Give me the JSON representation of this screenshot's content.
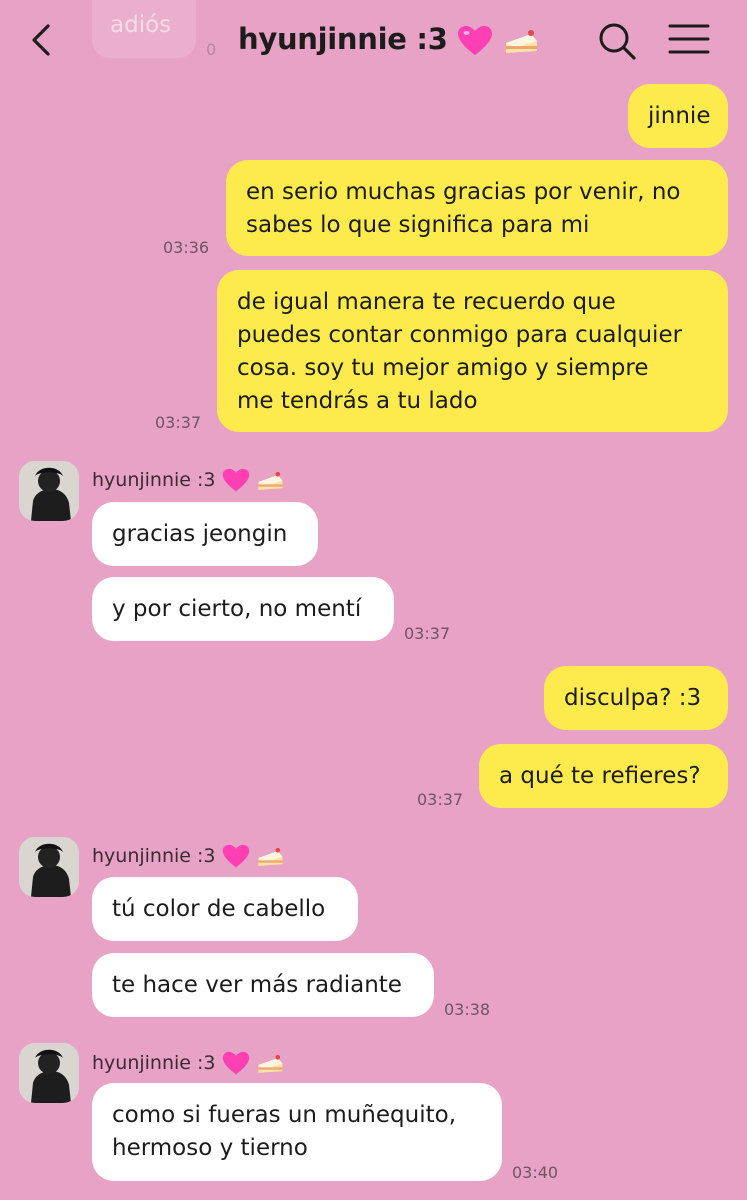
{
  "header": {
    "title": "hyunjinnie :3",
    "back_icon": "chevron-left-icon",
    "search_icon": "search-icon",
    "menu_icon": "hamburger-menu-icon"
  },
  "ghost": {
    "text": "adiós",
    "time": "0"
  },
  "contact": {
    "name": "hyunjinnie :3"
  },
  "colors": {
    "background": "#e7a2c5",
    "outgoing_bubble": "#fdeb4e",
    "incoming_bubble": "#ffffff"
  },
  "messages": [
    {
      "dir": "out",
      "text": [
        "jinnie"
      ]
    },
    {
      "dir": "out",
      "text": [
        "en serio muchas gracias por venir, no",
        "sabes lo que significa para mi"
      ],
      "time": "03:36"
    },
    {
      "dir": "out",
      "text": [
        "de igual manera te recuerdo que",
        "puedes contar conmigo para cualquier",
        "cosa. soy tu mejor amigo y siempre",
        "me tendrás a tu lado"
      ],
      "time": "03:37"
    },
    {
      "dir": "in",
      "sender": "hyunjinnie :3",
      "text": [
        "gracias jeongin"
      ]
    },
    {
      "dir": "in",
      "text": [
        "y por cierto, no mentí"
      ],
      "time": "03:37"
    },
    {
      "dir": "out",
      "text": [
        "disculpa? :3"
      ]
    },
    {
      "dir": "out",
      "text": [
        "a qué te refieres?"
      ],
      "time": "03:37"
    },
    {
      "dir": "in",
      "sender": "hyunjinnie :3",
      "text": [
        "tú color de cabello"
      ]
    },
    {
      "dir": "in",
      "text": [
        "te hace ver más radiante"
      ],
      "time": "03:38"
    },
    {
      "dir": "in",
      "sender": "hyunjinnie :3",
      "text": [
        "como si fueras un muñequito,",
        "hermoso y tierno"
      ],
      "time": "03:40"
    }
  ]
}
